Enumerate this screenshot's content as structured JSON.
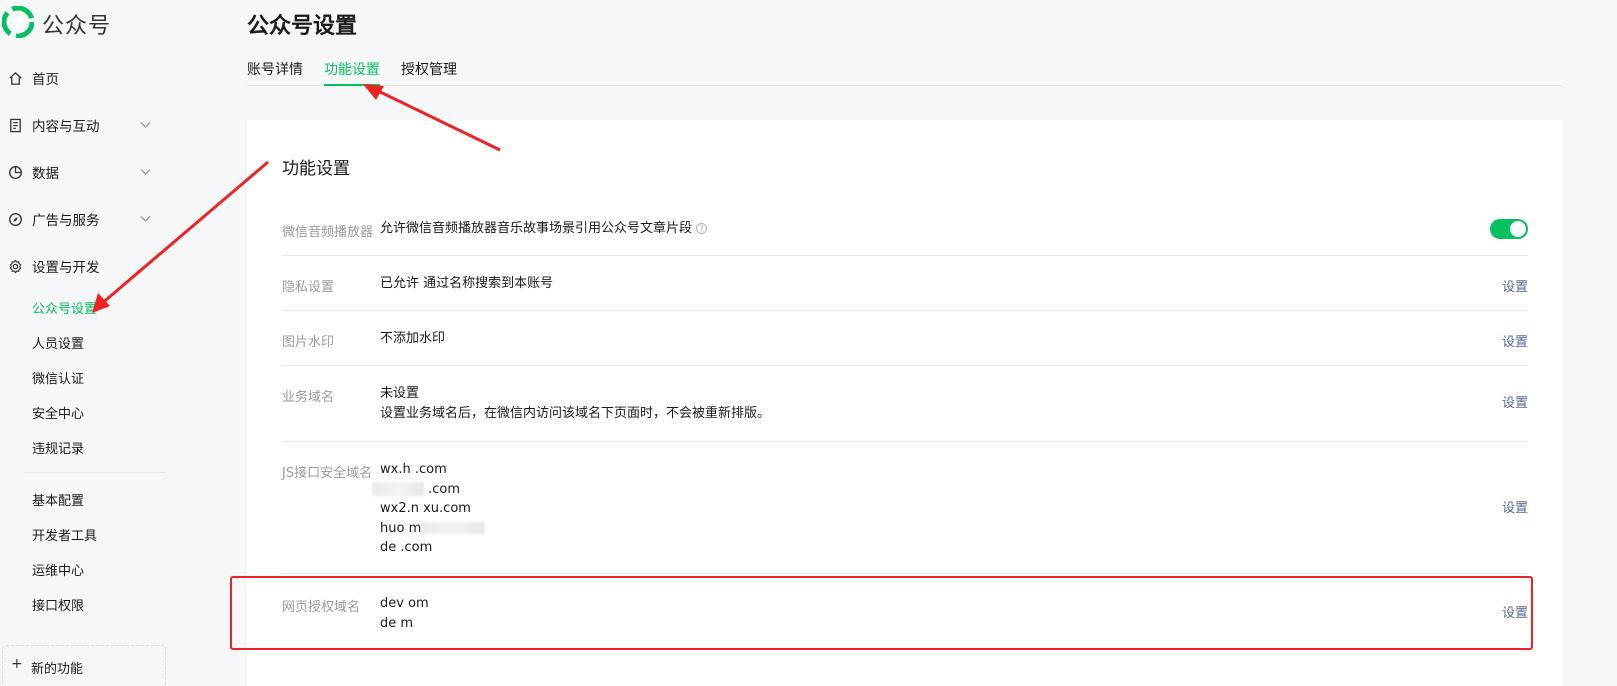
{
  "app": {
    "name": "公众号"
  },
  "sidebar": {
    "items": [
      {
        "label": "首页",
        "icon": "home-icon",
        "expandable": false
      },
      {
        "label": "内容与互动",
        "icon": "document-icon",
        "expandable": true
      },
      {
        "label": "数据",
        "icon": "pie-chart-icon",
        "expandable": true
      },
      {
        "label": "广告与服务",
        "icon": "compass-icon",
        "expandable": true
      },
      {
        "label": "设置与开发",
        "icon": "gear-icon",
        "expandable": false
      }
    ],
    "sub_items": [
      {
        "label": "公众号设置",
        "active": true
      },
      {
        "label": "人员设置",
        "active": false
      },
      {
        "label": "微信认证",
        "active": false
      },
      {
        "label": "安全中心",
        "active": false
      },
      {
        "label": "违规记录",
        "active": false
      }
    ],
    "dev_items": [
      {
        "label": "基本配置"
      },
      {
        "label": "开发者工具"
      },
      {
        "label": "运维中心"
      },
      {
        "label": "接口权限"
      }
    ],
    "bottom_label": "新的功能"
  },
  "page": {
    "title": "公众号设置",
    "tabs": [
      {
        "label": "账号详情",
        "active": false
      },
      {
        "label": "功能设置",
        "active": true
      },
      {
        "label": "授权管理",
        "active": false
      }
    ]
  },
  "card": {
    "title": "功能设置",
    "rows": [
      {
        "label": "微信音频播放器",
        "value_lines": [
          "允许微信音频播放器音乐故事场景引用公众号文章片段"
        ],
        "action": "",
        "toggle_on": true
      },
      {
        "label": "隐私设置",
        "value_lines": [
          "已允许 通过名称搜索到本账号"
        ],
        "action": "设置"
      },
      {
        "label": "图片水印",
        "value_lines": [
          "不添加水印"
        ],
        "action": "设置"
      },
      {
        "label": "业务域名",
        "value_lines": [
          "未设置",
          "设置业务域名后，在微信内访问该域名下页面时，不会被重新排版。"
        ],
        "action": "设置"
      },
      {
        "label": "JS接口安全域名",
        "value_lines": [
          "wx.h     .com",
          "          .com",
          "wx2.n       xu.com",
          "huo           m",
          "de                                 .com"
        ],
        "action": "设置"
      },
      {
        "label": "网页授权域名",
        "value_lines": [
          "dev                        om",
          "de               m"
        ],
        "action": "设置"
      }
    ]
  },
  "colors": {
    "accent": "#07c160",
    "link": "#576b95",
    "annotation": "#ee2222"
  }
}
